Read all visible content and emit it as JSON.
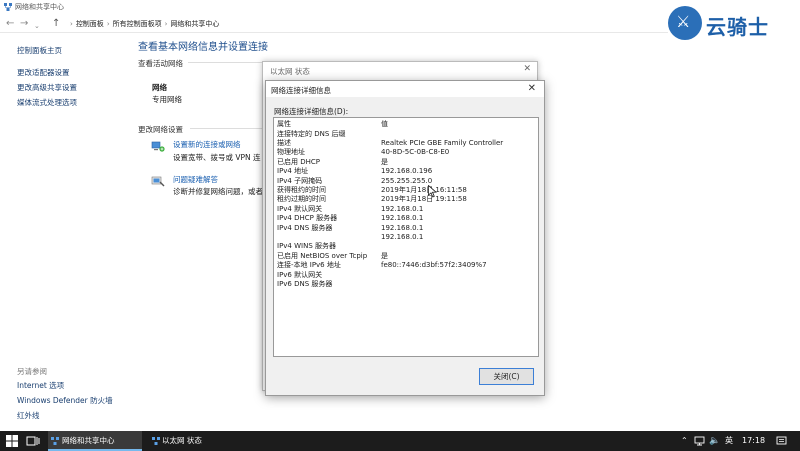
{
  "window": {
    "title": "网络和共享中心"
  },
  "breadcrumb": [
    "控制面板",
    "所有控制面板项",
    "网络和共享中心"
  ],
  "logo": {
    "text": "云骑士"
  },
  "left_nav": {
    "top": [
      "控制面板主页",
      "更改适配器设置",
      "更改高级共享设置",
      "媒体流式处理选项"
    ],
    "see_also_header": "另请参阅",
    "see_also": [
      "Internet 选项",
      "Windows Defender 防火墙",
      "红外线"
    ]
  },
  "main": {
    "heading": "查看基本网络信息并设置连接",
    "active_networks_label": "查看活动网络",
    "network_name": "网络",
    "network_type": "专用网络",
    "change_settings_label": "更改网络设置",
    "task1_title": "设置新的连接或网络",
    "task1_desc": "设置宽带、拨号或 VPN 连",
    "task2_title": "问题疑难解答",
    "task2_desc": "诊断并修复网络问题，或者"
  },
  "status_window": {
    "title": "以太网 状态",
    "close": "✕"
  },
  "details_dialog": {
    "title": "网络连接详细信息",
    "close": "✕",
    "list_label": "网络连接详细信息(D):",
    "columns": [
      "属性",
      "值"
    ],
    "rows": [
      [
        "连接特定的 DNS 后缀",
        ""
      ],
      [
        "描述",
        "Realtek PCIe GBE Family Controller"
      ],
      [
        "物理地址",
        "40-8D-5C-0B-C8-E0"
      ],
      [
        "已启用 DHCP",
        "是"
      ],
      [
        "IPv4 地址",
        "192.168.0.196"
      ],
      [
        "IPv4 子网掩码",
        "255.255.255.0"
      ],
      [
        "获得租约的时间",
        "2019年1月18日 16:11:58"
      ],
      [
        "租约过期的时间",
        "2019年1月18日 19:11:58"
      ],
      [
        "IPv4 默认网关",
        "192.168.0.1"
      ],
      [
        "IPv4 DHCP 服务器",
        "192.168.0.1"
      ],
      [
        "IPv4 DNS 服务器",
        "192.168.0.1"
      ],
      [
        "",
        "192.168.0.1"
      ],
      [
        "IPv4 WINS 服务器",
        ""
      ],
      [
        "已启用 NetBIOS over Tcpip",
        "是"
      ],
      [
        "连接-本地 IPv6 地址",
        "fe80::7446:d3bf:57f2:3409%7"
      ],
      [
        "IPv6 默认网关",
        ""
      ],
      [
        "IPv6 DNS 服务器",
        ""
      ]
    ],
    "close_button": "关闭(C)"
  },
  "taskbar": {
    "items": [
      "网络和共享中心",
      "以太网 状态"
    ],
    "ime": "英",
    "time": "17:18"
  }
}
